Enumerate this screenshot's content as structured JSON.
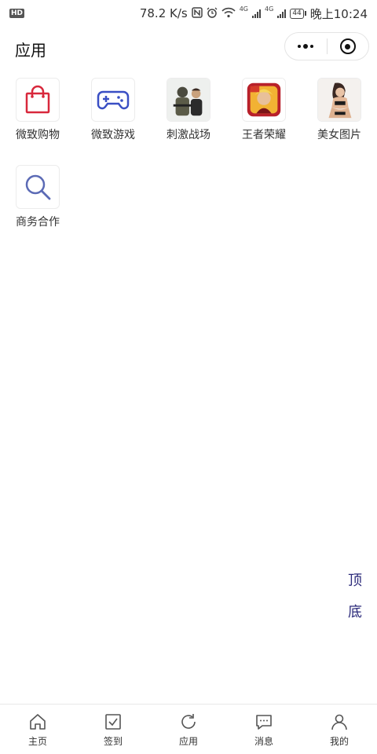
{
  "status_bar": {
    "hd": "HD",
    "network_speed": "78.2 K/s",
    "network_type_1": "4G",
    "network_type_2": "4G",
    "battery": "44",
    "time": "晚上10:24"
  },
  "header": {
    "title": "应用"
  },
  "apps": [
    {
      "label": "微致购物",
      "icon": "shopping-bag-icon"
    },
    {
      "label": "微致游戏",
      "icon": "gamepad-icon"
    },
    {
      "label": "刺激战场",
      "icon": "battle-game-icon"
    },
    {
      "label": "王者荣耀",
      "icon": "hero-game-icon"
    },
    {
      "label": "美女图片",
      "icon": "photo-gallery-icon"
    },
    {
      "label": "商务合作",
      "icon": "search-icon"
    }
  ],
  "float_buttons": {
    "top": "顶",
    "bottom": "底"
  },
  "tab_bar": [
    {
      "label": "主页",
      "icon": "home-icon"
    },
    {
      "label": "签到",
      "icon": "checkin-icon"
    },
    {
      "label": "应用",
      "icon": "refresh-icon"
    },
    {
      "label": "消息",
      "icon": "message-icon"
    },
    {
      "label": "我的",
      "icon": "user-icon"
    }
  ],
  "colors": {
    "accent": "#2b2a7a",
    "bag_red": "#d8283c",
    "gamepad_blue": "#3a4fc4",
    "search_blue": "#5b6ab5"
  }
}
